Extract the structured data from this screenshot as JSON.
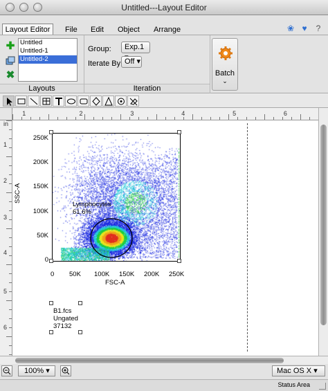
{
  "window": {
    "title": "Untitled---Layout Editor"
  },
  "menu": {
    "tab_active": "Layout Editor",
    "items": [
      "File",
      "Edit",
      "Object",
      "Arrange"
    ]
  },
  "layouts_panel": {
    "label": "Layouts",
    "items": [
      "Untitled",
      "Untitled-1",
      "Untitled-2"
    ],
    "selected_index": 2
  },
  "iteration_panel": {
    "label": "Iteration",
    "group_label": "Group:",
    "group_value": "Exp.1",
    "iterate_label": "Iterate By:",
    "iterate_value": "Off"
  },
  "batch": {
    "label": "Batch"
  },
  "rulers": {
    "unit": "in",
    "top_marks": [
      "1",
      "2",
      "3",
      "4",
      "5",
      "6"
    ],
    "left_marks": [
      "1",
      "2",
      "3",
      "4",
      "5",
      "6"
    ]
  },
  "plot": {
    "y_axis_label": "SSC-A",
    "x_axis_label": "FSC-A",
    "y_ticks": [
      "250K",
      "200K",
      "150K",
      "100K",
      "50K",
      "0"
    ],
    "x_ticks": [
      "0",
      "50K",
      "100K",
      "150K",
      "200K",
      "250K"
    ],
    "gate_name": "Lymphocytes",
    "gate_percent": "61.6%"
  },
  "annotation": {
    "line1": "B1.fcs",
    "line2": "Ungated",
    "line3": "37132"
  },
  "bottom": {
    "zoom_value": "100%",
    "theme_value": "Mac OS X",
    "status_text": "Status Area"
  },
  "colors": {
    "selection": "#3a6ed8",
    "density_high": "#e0301e",
    "density_mid": "#1ccf3c",
    "density_low": "#1b2adf"
  }
}
